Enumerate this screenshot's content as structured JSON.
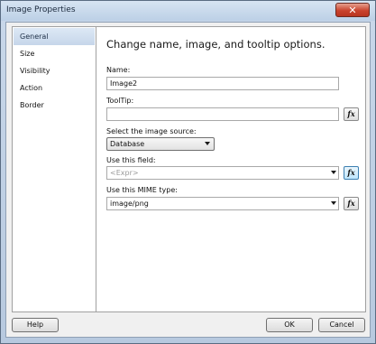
{
  "window": {
    "title": "Image Properties",
    "close_glyph": "✕"
  },
  "sidebar": {
    "items": [
      {
        "label": "General",
        "selected": true
      },
      {
        "label": "Size",
        "selected": false
      },
      {
        "label": "Visibility",
        "selected": false
      },
      {
        "label": "Action",
        "selected": false
      },
      {
        "label": "Border",
        "selected": false
      }
    ]
  },
  "main": {
    "heading": "Change name, image, and tooltip options.",
    "name": {
      "label": "Name:",
      "value": "Image2"
    },
    "tooltip": {
      "label": "ToolTip:",
      "value": "",
      "expr_button": "fx"
    },
    "image_source": {
      "label": "Select the image source:",
      "value": "Database"
    },
    "field": {
      "label": "Use this field:",
      "value": "<Expr>",
      "expr_button": "fx"
    },
    "mime": {
      "label": "Use this MIME type:",
      "value": "image/png",
      "expr_button": "fx"
    }
  },
  "footer": {
    "help_label": "Help",
    "ok_label": "OK",
    "cancel_label": "Cancel"
  }
}
